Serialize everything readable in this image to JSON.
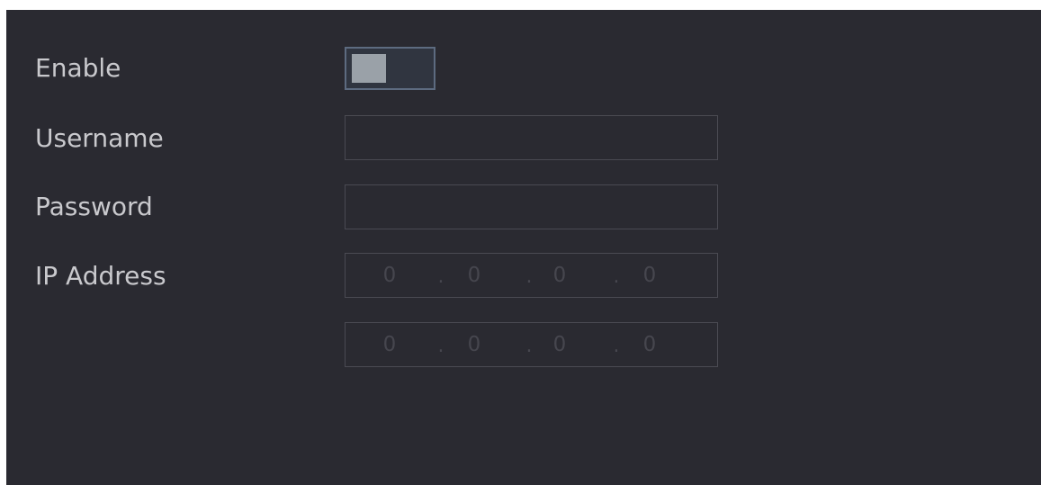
{
  "form": {
    "enable": {
      "label": "Enable",
      "value": false
    },
    "username": {
      "label": "Username",
      "value": ""
    },
    "password": {
      "label": "Password",
      "value": ""
    },
    "ip_address": {
      "label": "IP Address",
      "primary": [
        "0",
        "0",
        "0",
        "0"
      ],
      "secondary": [
        "0",
        "0",
        "0",
        "0"
      ],
      "separator": "."
    }
  },
  "colors": {
    "panel_background": "#2a2a31",
    "label_text": "#c9c9cd",
    "field_border": "#4a4a52",
    "toggle_border": "#5d6b80",
    "toggle_knob": "#9aa1a8",
    "ip_placeholder_text": "#46464e"
  }
}
